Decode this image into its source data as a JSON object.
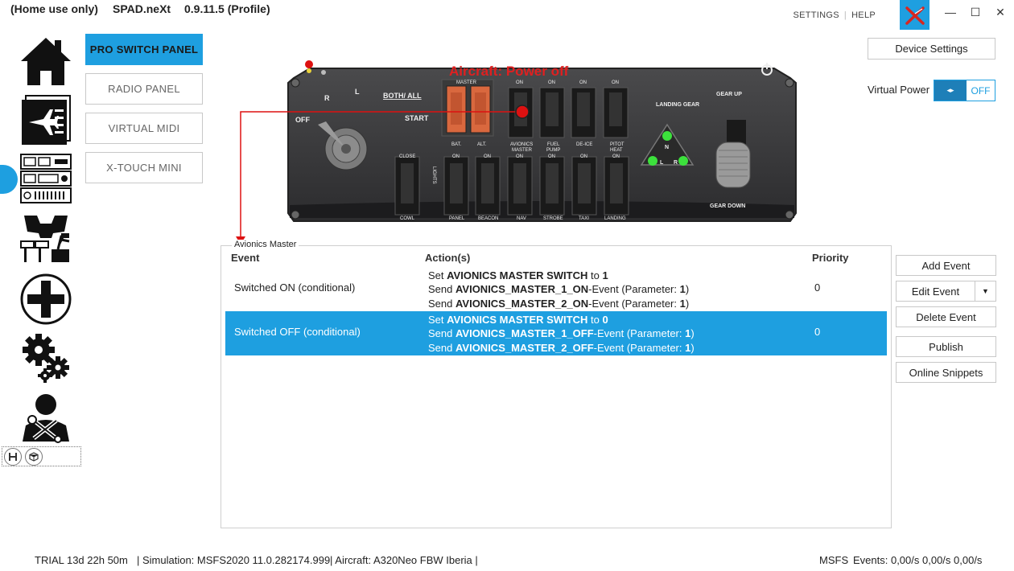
{
  "titlebar": {
    "mode": "(Home use only)",
    "app": "SPAD.neXt",
    "version": "0.9.11.5 (Profile)",
    "settings": "SETTINGS",
    "help": "HELP",
    "minimize": "—",
    "maximize": "☐",
    "close": "✕"
  },
  "devices": [
    {
      "label": "PRO SWITCH PANEL",
      "active": true
    },
    {
      "label": "RADIO PANEL"
    },
    {
      "label": "VIRTUAL MIDI"
    },
    {
      "label": "X-TOUCH MINI"
    }
  ],
  "panel": {
    "status_title": "Aircraft: Power off",
    "labels": {
      "off": "OFF",
      "r": "R",
      "l": "L",
      "both": "BOTH/ ALL",
      "start": "START",
      "master": "MASTER",
      "bat": "BAT.",
      "alt": "ALT.",
      "on": "ON",
      "avionics": "AVIONICS",
      "avionics2": "MASTER",
      "fuel": "FUEL",
      "pump": "PUMP",
      "deice": "DE-ICE",
      "pitot": "PITOT",
      "heat": "HEAT",
      "landing_gear": "LANDING GEAR",
      "gear_up": "GEAR UP",
      "gear_down": "GEAR DOWN",
      "n": "N",
      "lg_l": "L",
      "lg_r": "R",
      "close": "CLOSE",
      "cowl": "COWL",
      "lights": "LIGHTS",
      "panel": "PANEL",
      "beacon": "BEACON",
      "nav": "NAV",
      "strobe": "STROBE",
      "taxi": "TAXI",
      "landing": "LANDING"
    }
  },
  "right": {
    "device_settings": "Device Settings",
    "virtual_power": "Virtual Power",
    "vp_state": "OFF",
    "vp_knob": "◂▸"
  },
  "events": {
    "group_title": "Avionics Master",
    "headers": {
      "event": "Event",
      "actions": "Action(s)",
      "priority": "Priority"
    },
    "rows": [
      {
        "event": "Switched ON (conditional)",
        "priority": "0",
        "a1_pre": "Set ",
        "a1_bold": "AVIONICS MASTER SWITCH",
        "a1_mid": " to ",
        "a1_val": "1",
        "a2_pre": "Send ",
        "a2_bold": "AVIONICS_MASTER_1_ON",
        "a2_mid": "-Event (Parameter: ",
        "a2_val": "1",
        "a2_end": ")",
        "a3_pre": "Send ",
        "a3_bold": "AVIONICS_MASTER_2_ON",
        "a3_mid": "-Event (Parameter: ",
        "a3_val": "1",
        "a3_end": ")"
      },
      {
        "event": "Switched OFF (conditional)",
        "priority": "0",
        "a1_pre": "Set ",
        "a1_bold": "AVIONICS MASTER SWITCH",
        "a1_mid": " to ",
        "a1_val": "0",
        "a2_pre": "Send ",
        "a2_bold": "AVIONICS_MASTER_1_OFF",
        "a2_mid": "-Event (Parameter: ",
        "a2_val": "1",
        "a2_end": ")",
        "a3_pre": "Send ",
        "a3_bold": "AVIONICS_MASTER_2_OFF",
        "a3_mid": "-Event (Parameter: ",
        "a3_val": "1",
        "a3_end": ")"
      }
    ],
    "buttons": {
      "add": "Add Event",
      "edit": "Edit Event",
      "edit_drop": "▼",
      "delete": "Delete Event",
      "publish": "Publish",
      "snippets": "Online Snippets"
    }
  },
  "status": {
    "trial": "TRIAL 13d 22h 50m",
    "simulation": "| Simulation: MSFS2020 11.0.282174.999",
    "aircraft": "| Aircraft: A320Neo FBW Iberia   |",
    "sim": "MSFS",
    "events": "Events: 0,00/s 0,00/s 0,00/s"
  },
  "colors": {
    "accent": "#1e9fe0",
    "alert": "#e02020"
  }
}
